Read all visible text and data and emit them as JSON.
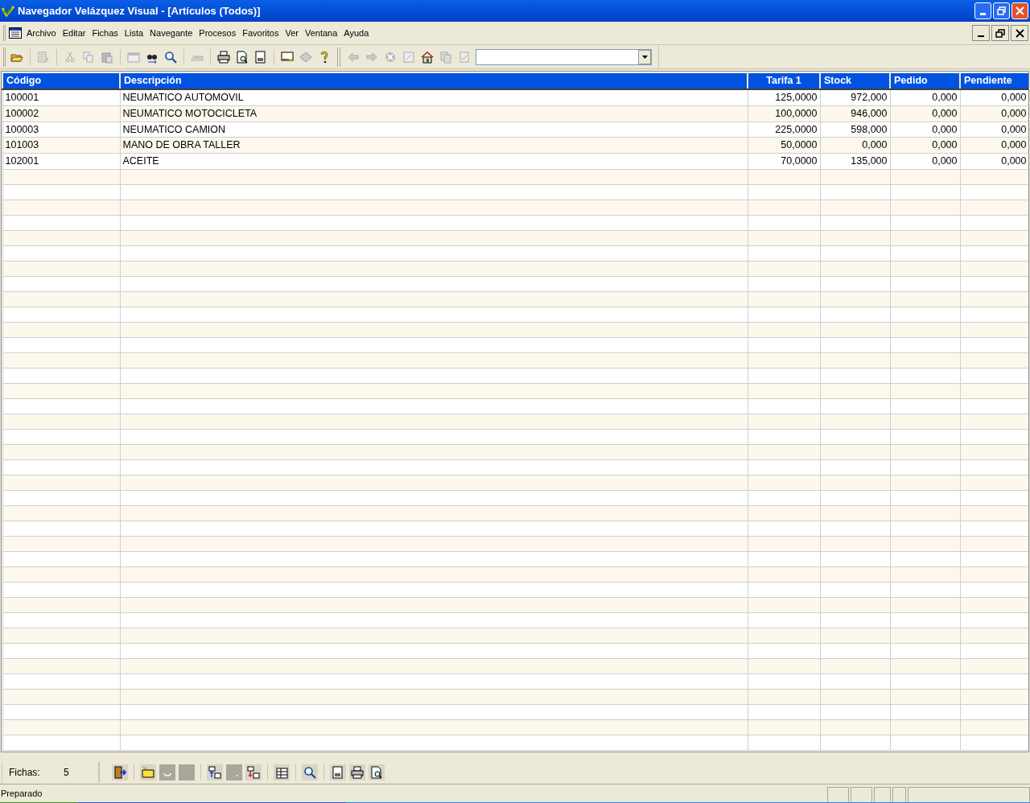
{
  "window": {
    "title": "Navegador Velázquez Visual - [Artículos (Todos)]"
  },
  "menu": [
    "Archivo",
    "Editar",
    "Fichas",
    "Lista",
    "Navegante",
    "Procesos",
    "Favoritos",
    "Ver",
    "Ventana",
    "Ayuda"
  ],
  "table": {
    "columns": [
      "Código",
      "Descripción",
      "Tarifa 1",
      "Stock",
      "Pedido",
      "Pendiente"
    ],
    "rows": [
      [
        "100001",
        "NEUMATICO AUTOMOVIL",
        "125,0000",
        "972,000",
        "0,000",
        "0,000"
      ],
      [
        "100002",
        "NEUMATICO MOTOCICLETA",
        "100,0000",
        "946,000",
        "0,000",
        "0,000"
      ],
      [
        "100003",
        "NEUMATICO CAMION",
        "225,0000",
        "598,000",
        "0,000",
        "0,000"
      ],
      [
        "101003",
        "MANO DE OBRA TALLER",
        "50,0000",
        "0,000",
        "0,000",
        "0,000"
      ],
      [
        "102001",
        "ACEITE",
        "70,0000",
        "135,000",
        "0,000",
        "0,000"
      ]
    ]
  },
  "record_count": {
    "label": "Fichas:",
    "value": "5"
  },
  "status_bar": {
    "text": "Preparado"
  }
}
